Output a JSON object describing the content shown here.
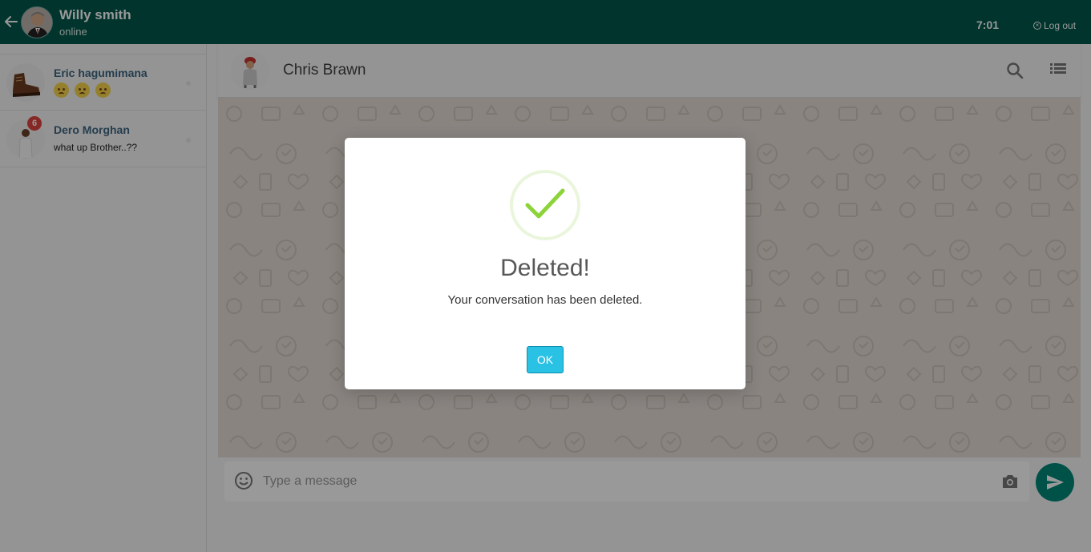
{
  "header": {
    "user_name": "Willy smith",
    "user_status": "online",
    "time": "7:01",
    "logout_label": "Log out"
  },
  "contacts": [
    {
      "name": "Eric hagumimana",
      "message": "",
      "emoji_count": 3,
      "unread": null
    },
    {
      "name": "Dero Morghan",
      "message": "what up Brother..??",
      "unread": "6"
    }
  ],
  "chat": {
    "contact_name": "Chris Brawn"
  },
  "composer": {
    "placeholder": "Type a message"
  },
  "dialog": {
    "title": "Deleted!",
    "message": "Your conversation has been deleted.",
    "ok_label": "OK"
  },
  "colors": {
    "topbar": "#00574b",
    "accent": "#00897b",
    "ok_button": "#29c2e5",
    "check": "#8cd43a",
    "badge": "#e0443f"
  }
}
